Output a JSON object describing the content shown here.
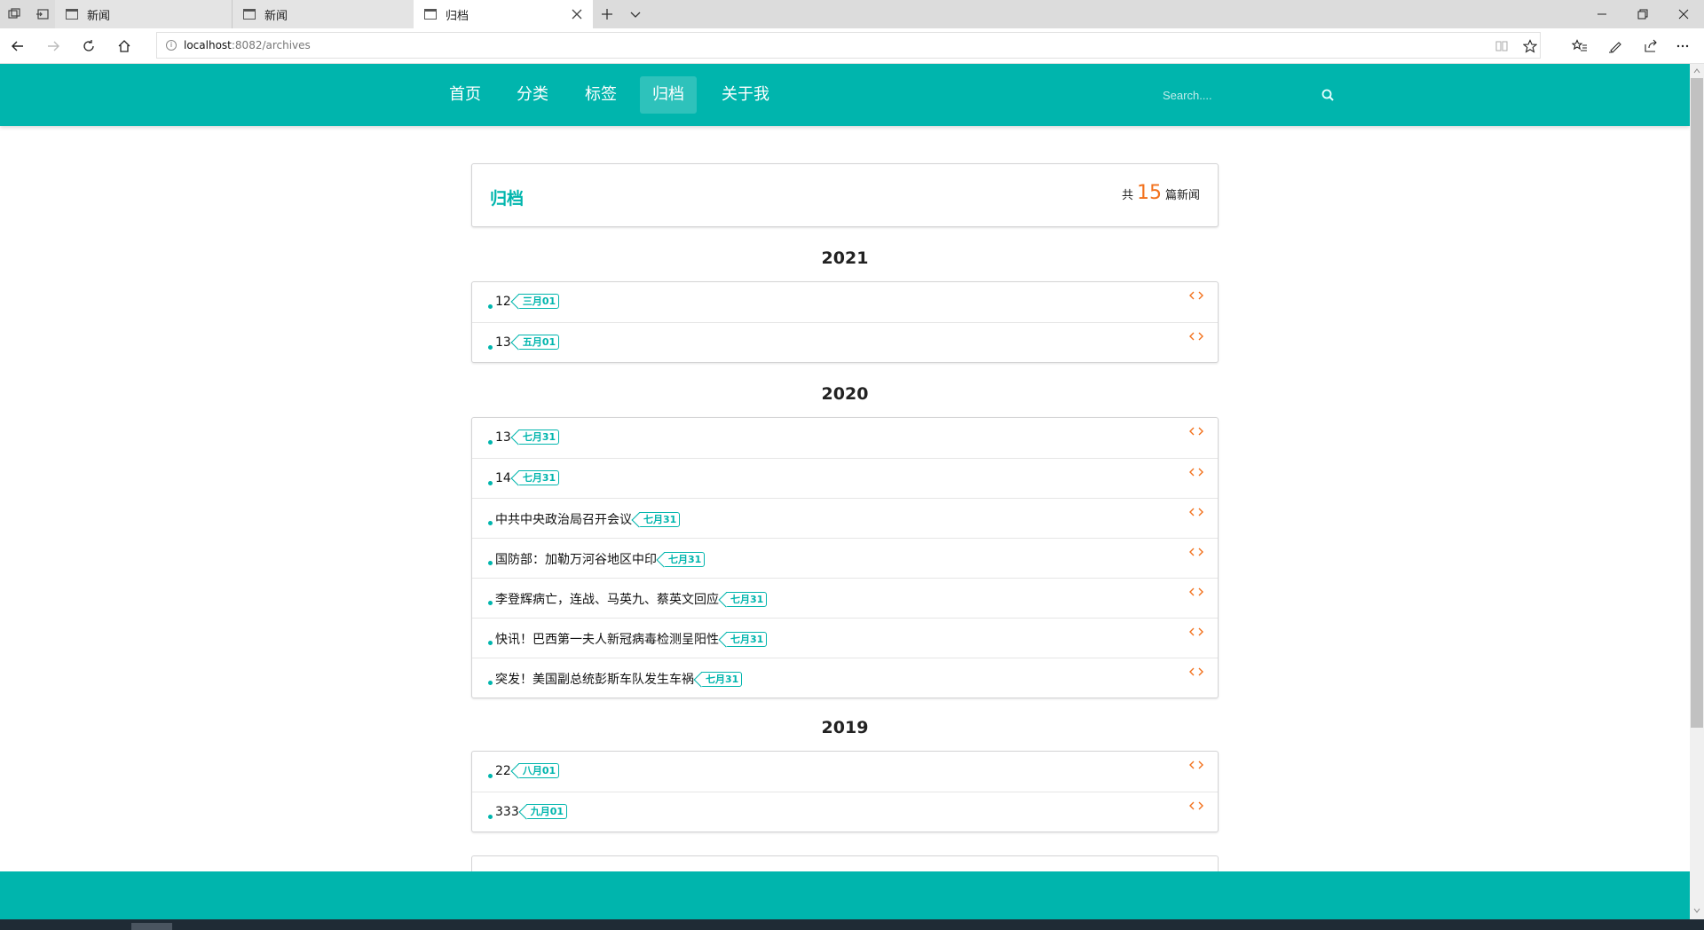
{
  "browser": {
    "tabs": [
      {
        "label": "新闻"
      },
      {
        "label": "新闻"
      },
      {
        "label": "归档"
      }
    ],
    "url_host": "localhost",
    "url_rest": ":8082/archives"
  },
  "nav": {
    "items": [
      {
        "label": "首页"
      },
      {
        "label": "分类"
      },
      {
        "label": "标签"
      },
      {
        "label": "归档",
        "active": true
      },
      {
        "label": "关于我"
      }
    ],
    "search_placeholder": "Search...."
  },
  "header": {
    "title": "归档",
    "count_prefix": "共",
    "count": "15",
    "count_suffix": "篇新闻"
  },
  "archives": [
    {
      "year": "2021",
      "items": [
        {
          "title": "12",
          "date": "三月01"
        },
        {
          "title": "13",
          "date": "五月01"
        }
      ]
    },
    {
      "year": "2020",
      "items": [
        {
          "title": "13",
          "date": "七月31"
        },
        {
          "title": "14",
          "date": "七月31"
        },
        {
          "title": "中共中央政治局召开会议",
          "date": "七月31"
        },
        {
          "title": "国防部：加勒万河谷地区中印",
          "date": "七月31"
        },
        {
          "title": "李登辉病亡，连战、马英九、蔡英文回应",
          "date": "七月31"
        },
        {
          "title": "快讯！巴西第一夫人新冠病毒检测呈阳性",
          "date": "七月31"
        },
        {
          "title": "突发！美国副总统彭斯车队发生车祸",
          "date": "七月31"
        }
      ]
    },
    {
      "year": "2019",
      "items": [
        {
          "title": "22",
          "date": "八月01"
        },
        {
          "title": "333",
          "date": "九月01"
        }
      ]
    }
  ],
  "colors": {
    "primary": "#00b5ad",
    "accent": "#f2711c"
  }
}
